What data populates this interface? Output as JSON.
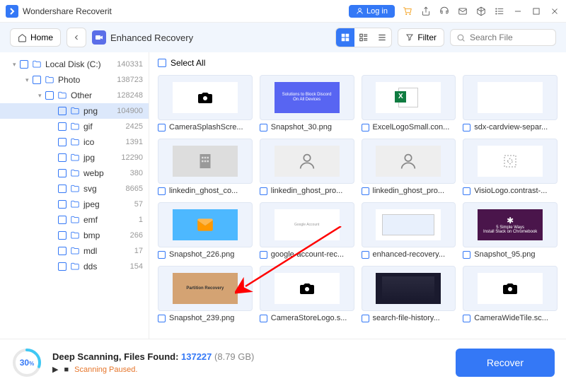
{
  "app": {
    "title": "Wondershare Recoverit",
    "login": "Log in"
  },
  "toolbar": {
    "home": "Home",
    "mode": "Enhanced Recovery",
    "filter": "Filter",
    "search_placeholder": "Search File"
  },
  "tree": [
    {
      "indent": 0,
      "chev": "▾",
      "name": "Local Disk (C:)",
      "count": "140331",
      "sel": false
    },
    {
      "indent": 1,
      "chev": "▾",
      "name": "Photo",
      "count": "138723",
      "sel": false
    },
    {
      "indent": 2,
      "chev": "▾",
      "name": "Other",
      "count": "128248",
      "sel": false
    },
    {
      "indent": 3,
      "chev": "",
      "name": "png",
      "count": "104900",
      "sel": true
    },
    {
      "indent": 3,
      "chev": "",
      "name": "gif",
      "count": "2425",
      "sel": false
    },
    {
      "indent": 3,
      "chev": "",
      "name": "ico",
      "count": "1391",
      "sel": false
    },
    {
      "indent": 3,
      "chev": "",
      "name": "jpg",
      "count": "12290",
      "sel": false
    },
    {
      "indent": 3,
      "chev": "",
      "name": "webp",
      "count": "380",
      "sel": false
    },
    {
      "indent": 3,
      "chev": "",
      "name": "svg",
      "count": "8665",
      "sel": false
    },
    {
      "indent": 3,
      "chev": "",
      "name": "jpeg",
      "count": "57",
      "sel": false
    },
    {
      "indent": 3,
      "chev": "",
      "name": "emf",
      "count": "1",
      "sel": false
    },
    {
      "indent": 3,
      "chev": "",
      "name": "bmp",
      "count": "266",
      "sel": false
    },
    {
      "indent": 3,
      "chev": "",
      "name": "mdl",
      "count": "17",
      "sel": false
    },
    {
      "indent": 3,
      "chev": "",
      "name": "dds",
      "count": "154",
      "sel": false
    }
  ],
  "select_all": "Select All",
  "files": [
    {
      "name": "CameraSplashScre...",
      "glyph": "camera"
    },
    {
      "name": "Snapshot_30.png",
      "glyph": "discord"
    },
    {
      "name": "ExcelLogoSmall.con...",
      "glyph": "excel"
    },
    {
      "name": "sdx-cardview-separ...",
      "glyph": "blank"
    },
    {
      "name": "linkedin_ghost_co...",
      "glyph": "building"
    },
    {
      "name": "linkedin_ghost_pro...",
      "glyph": "person"
    },
    {
      "name": "linkedin_ghost_pro...",
      "glyph": "person"
    },
    {
      "name": "VisioLogo.contrast-...",
      "glyph": "visio"
    },
    {
      "name": "Snapshot_226.png",
      "glyph": "mail"
    },
    {
      "name": "google-account-rec...",
      "glyph": "google"
    },
    {
      "name": "enhanced-recovery...",
      "glyph": "screen"
    },
    {
      "name": "Snapshot_95.png",
      "glyph": "slack"
    },
    {
      "name": "Snapshot_239.png",
      "glyph": "laptop"
    },
    {
      "name": "CameraStoreLogo.s...",
      "glyph": "camera"
    },
    {
      "name": "search-file-history...",
      "glyph": "dark"
    },
    {
      "name": "CameraWideTile.sc...",
      "glyph": "camera"
    }
  ],
  "footer": {
    "title_prefix": "Deep Scanning, Files Found: ",
    "count": "137227",
    "size": "(8.79 GB)",
    "status": "Scanning Paused.",
    "recover": "Recover",
    "percent": "30"
  }
}
